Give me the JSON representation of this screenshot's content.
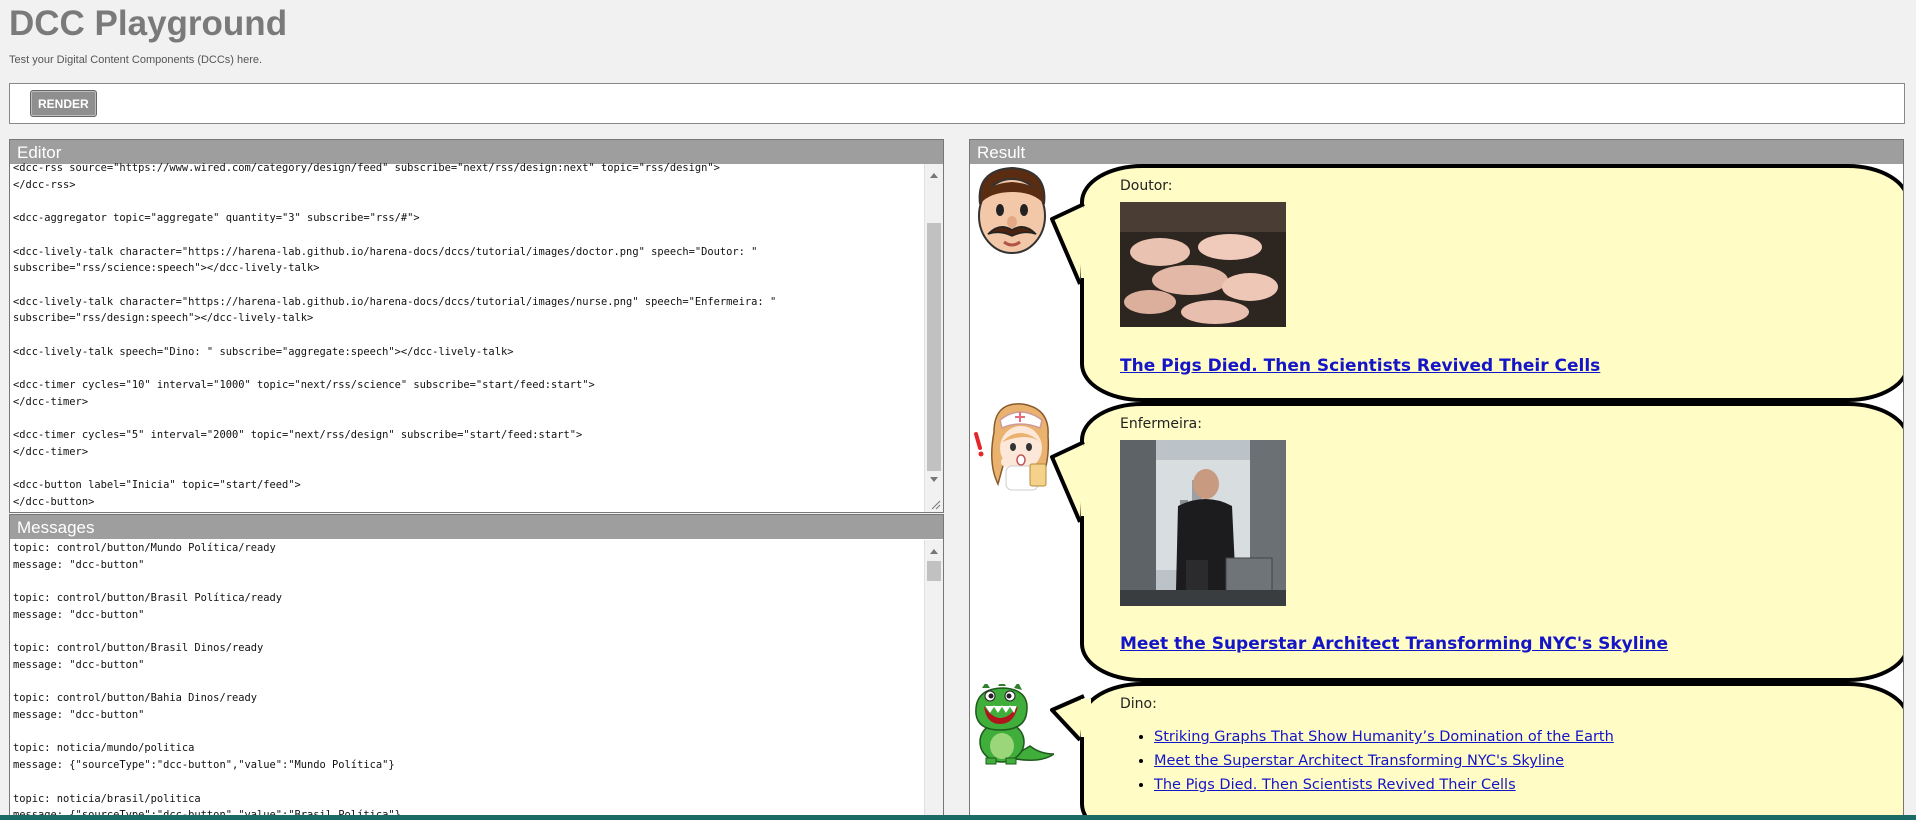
{
  "app": {
    "title": "DCC Playground",
    "subtitle": "Test your Digital Content Components (DCCs) here."
  },
  "toolbar": {
    "render_label": "RENDER"
  },
  "editor": {
    "title": "Editor",
    "code": "<dcc-rss source=\"https://www.wired.com/category/design/feed\" subscribe=\"next/rss/design:next\" topic=\"rss/design\">\n</dcc-rss>\n\n<dcc-aggregator topic=\"aggregate\" quantity=\"3\" subscribe=\"rss/#\">\n\n<dcc-lively-talk character=\"https://harena-lab.github.io/harena-docs/dccs/tutorial/images/doctor.png\" speech=\"Doutor: \"\nsubscribe=\"rss/science:speech\"></dcc-lively-talk>\n\n<dcc-lively-talk character=\"https://harena-lab.github.io/harena-docs/dccs/tutorial/images/nurse.png\" speech=\"Enfermeira: \"\nsubscribe=\"rss/design:speech\"></dcc-lively-talk>\n\n<dcc-lively-talk speech=\"Dino: \" subscribe=\"aggregate:speech\"></dcc-lively-talk>\n\n<dcc-timer cycles=\"10\" interval=\"1000\" topic=\"next/rss/science\" subscribe=\"start/feed:start\">\n</dcc-timer>\n\n<dcc-timer cycles=\"5\" interval=\"2000\" topic=\"next/rss/design\" subscribe=\"start/feed:start\">\n</dcc-timer>\n\n<dcc-button label=\"Inicia\" topic=\"start/feed\">\n</dcc-button>"
  },
  "messages": {
    "title": "Messages",
    "log": "topic: control/button/Mundo Política/ready\nmessage: \"dcc-button\"\n\ntopic: control/button/Brasil Política/ready\nmessage: \"dcc-button\"\n\ntopic: control/button/Brasil Dinos/ready\nmessage: \"dcc-button\"\n\ntopic: control/button/Bahia Dinos/ready\nmessage: \"dcc-button\"\n\ntopic: noticia/mundo/politica\nmessage: {\"sourceType\":\"dcc-button\",\"value\":\"Mundo Política\"}\n\ntopic: noticia/brasil/politica\nmessage: {\"sourceType\":\"dcc-button\",\"value\":\"Brasil Política\"}"
  },
  "result": {
    "title": "Result",
    "talks": [
      {
        "speaker": "Doutor:",
        "link": "The Pigs Died. Then Scientists Revived Their Cells",
        "avatar_icon": "doctor-avatar-icon"
      },
      {
        "speaker": "Enfermeira:",
        "link": "Meet the Superstar Architect Transforming NYC's Skyline",
        "avatar_icon": "nurse-avatar-icon"
      },
      {
        "speaker": "Dino:",
        "avatar_icon": "dino-avatar-icon",
        "items": [
          "Striking Graphs That Show Humanity’s Domination of the Earth",
          "Meet the Superstar Architect Transforming NYC's Skyline",
          "The Pigs Died. Then Scientists Revived Their Cells"
        ]
      }
    ]
  },
  "colors": {
    "panel_header": "#9e9e9e",
    "bubble_fill": "#fffcc6",
    "link": "#1515c8",
    "render_button": "#8f8f8f"
  }
}
